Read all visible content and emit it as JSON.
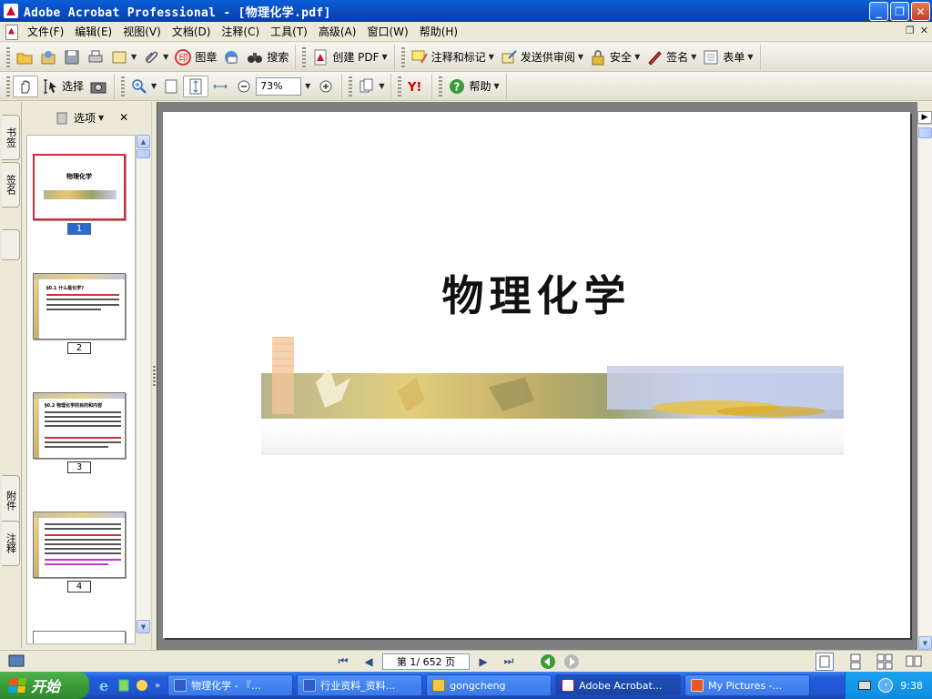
{
  "window": {
    "title": "Adobe Acrobat Professional - [物理化学.pdf]",
    "minimize": "_",
    "restore": "❐",
    "close": "✕"
  },
  "menu": {
    "items": [
      "文件(F)",
      "编辑(E)",
      "视图(V)",
      "文档(D)",
      "注释(C)",
      "工具(T)",
      "高级(A)",
      "窗口(W)",
      "帮助(H)"
    ],
    "mdi_restore": "❐",
    "mdi_close": "✕"
  },
  "toolbar1": {
    "stamp": "图章",
    "search": "搜索",
    "create_pdf": "创建 PDF",
    "comment": "注释和标记",
    "review": "发送供审阅",
    "security": "安全",
    "sign": "签名",
    "forms": "表单"
  },
  "toolbar2": {
    "select": "选择",
    "zoom_value": "73%",
    "help": "帮助"
  },
  "nav_tabs": {
    "bookmarks": "书签",
    "signatures": "签名",
    "attachments": "附件",
    "comments": "注释"
  },
  "thumbnails": {
    "options_label": "选项",
    "close": "✕",
    "pages": [
      {
        "number": "1",
        "title": "物理化学"
      },
      {
        "number": "2",
        "title": "§0.1 什么是化学?"
      },
      {
        "number": "3",
        "title": "§0.2 物理化学的目的和内容"
      },
      {
        "number": "4",
        "title": ""
      }
    ]
  },
  "document": {
    "title": "物理化学"
  },
  "status": {
    "page_indicator": "第 1/ 652 页"
  },
  "taskbar": {
    "start": "开始",
    "tasks": [
      {
        "label": "物理化学 - 『..."
      },
      {
        "label": "行业资料_资料..."
      },
      {
        "label": "gongcheng"
      },
      {
        "label": "Adobe Acrobat..."
      },
      {
        "label": "My Pictures -..."
      }
    ],
    "clock": "9:38"
  },
  "colors": {
    "titlebar": "#0a4fc4",
    "selection": "#316ac5",
    "start_green": "#3a9b38",
    "page_bg": "#ffffff",
    "desktop_gray": "#7f7f7f"
  }
}
